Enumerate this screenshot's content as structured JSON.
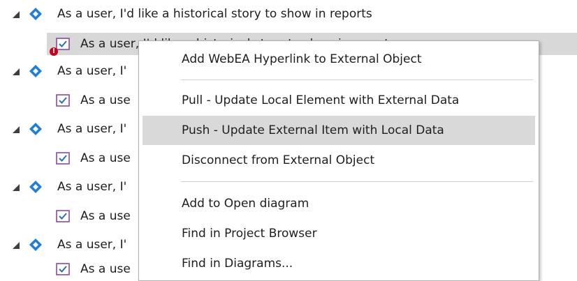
{
  "tree": {
    "rows": [
      {
        "kind": "parent",
        "label": "As a user, I'd like a historical story to show in reports"
      },
      {
        "kind": "child",
        "label": "As a user, I'd like a historical story to show in reports"
      },
      {
        "kind": "parent",
        "label": "As a user, I'"
      },
      {
        "kind": "child",
        "label": "As a use"
      },
      {
        "kind": "parent",
        "label": "As a user, I'"
      },
      {
        "kind": "child",
        "label": "As a use"
      },
      {
        "kind": "parent",
        "label": "As a user, I'"
      },
      {
        "kind": "child",
        "label": "As a use"
      },
      {
        "kind": "parent",
        "label": "As a user, I'"
      },
      {
        "kind": "child",
        "label": "As a use"
      }
    ],
    "error_badge_glyph": "!"
  },
  "context_menu": {
    "items": [
      {
        "label": "Add WebEA Hyperlink to External Object"
      },
      {
        "label": "Pull - Update Local Element with External Data"
      },
      {
        "label": "Push - Update External Item with Local Data"
      },
      {
        "label": "Disconnect from External Object"
      },
      {
        "label": "Add to Open diagram"
      },
      {
        "label": "Find in Project Browser"
      },
      {
        "label": "Find in Diagrams..."
      }
    ],
    "highlighted_item": "Push - Update External Item with Local Data"
  },
  "colors": {
    "diamond_blue": "#1e7fd8",
    "selection_gray": "#d8d8d8",
    "menu_highlight_gray": "#d9d9d9",
    "error_red": "#c2001b",
    "requirement_icon_purple": "#8a4a9c"
  },
  "icons": {
    "parent_node_icon": "blue-diamond-icon",
    "child_node_icon": "requirement-checkbox-icon",
    "expander_icon": "expanded-triangle-icon",
    "error_icon": "error-badge-icon"
  }
}
